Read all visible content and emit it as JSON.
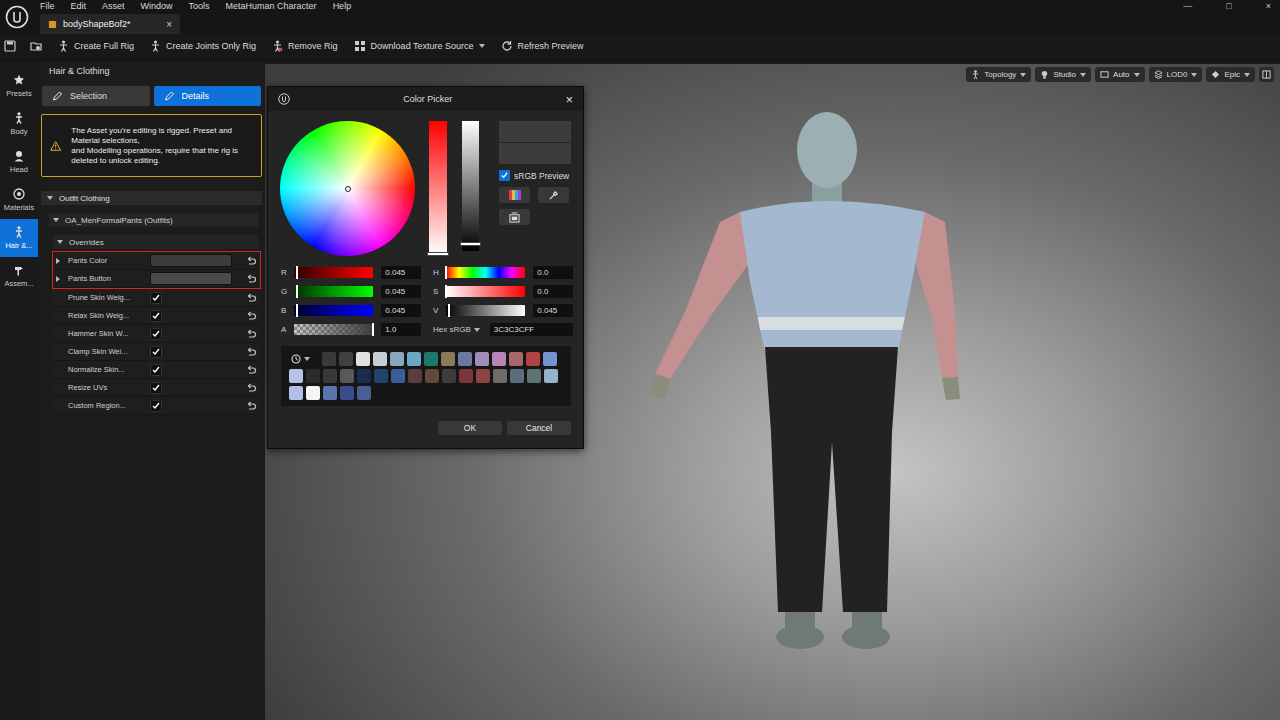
{
  "app": {
    "menu": [
      "File",
      "Edit",
      "Asset",
      "Window",
      "Tools",
      "MetaHuman Character",
      "Help"
    ],
    "window_controls": [
      "—",
      "□",
      "×"
    ],
    "document_tab": {
      "label": "bodyShapeBof2*",
      "close": "×",
      "selected": true
    }
  },
  "toolbar": [
    {
      "label": "Create Full Rig",
      "kind": "rig"
    },
    {
      "label": "Create Joints Only Rig",
      "kind": "joints"
    },
    {
      "label": "Remove Rig",
      "kind": "remove"
    },
    {
      "label": "Download Texture Source",
      "kind": "download",
      "dropdown": true
    },
    {
      "label": "Refresh Preview",
      "kind": "refresh"
    }
  ],
  "rail": [
    {
      "label": "Presets",
      "kind": "star",
      "selected": false
    },
    {
      "label": "Body",
      "kind": "body",
      "selected": false
    },
    {
      "label": "Head",
      "kind": "head",
      "selected": false
    },
    {
      "label": "Materials",
      "kind": "materials",
      "selected": false
    },
    {
      "label": "Hair &...",
      "kind": "hair",
      "selected": true
    },
    {
      "label": "Assem...",
      "kind": "hammer",
      "selected": false
    }
  ],
  "panel": {
    "title": "Hair & Clothing",
    "tabs": [
      {
        "label": "Selection",
        "selected": false
      },
      {
        "label": "Details",
        "selected": true
      }
    ],
    "warning": "The Asset you're editing is rigged. Preset and Material selections,\nand Modelling operations, require that the rig is deleted to unlock editing.",
    "section": {
      "label": "Outfit Clothing",
      "expanded": true
    },
    "outfit": {
      "label": "OA_MenFormalPants (Outfits)",
      "expanded": true
    },
    "group": {
      "label": "Overrides",
      "expanded": true
    },
    "rows": [
      {
        "label": "Pants Color",
        "kind": "color",
        "color": "#3c3c3c",
        "expanded": false,
        "highlighted": true
      },
      {
        "label": "Pants Button",
        "kind": "color",
        "color": "#4a4a4a",
        "expanded": false,
        "highlighted": true
      },
      {
        "label": "Prune Skin Weig...",
        "kind": "checkbox",
        "checked": true,
        "highlighted": false
      },
      {
        "label": "Relax Skin Weig...",
        "kind": "checkbox",
        "checked": true,
        "highlighted": false
      },
      {
        "label": "Hammer Skin W...",
        "kind": "checkbox",
        "checked": true,
        "highlighted": false
      },
      {
        "label": "Clamp Skin Wei...",
        "kind": "checkbox",
        "checked": true,
        "highlighted": false
      },
      {
        "label": "Normalize Skin...",
        "kind": "checkbox",
        "checked": true,
        "highlighted": false
      },
      {
        "label": "Resize UVs",
        "kind": "checkbox",
        "checked": true,
        "highlighted": false
      },
      {
        "label": "Custom Region...",
        "kind": "checkbox",
        "checked": true,
        "highlighted": false
      }
    ]
  },
  "viewport": {
    "controls": [
      {
        "label": "Topology",
        "kind": "figure"
      },
      {
        "label": "Studio",
        "kind": "bulb"
      },
      {
        "label": "Auto",
        "kind": "screen"
      },
      {
        "label": "LOD0",
        "kind": "stack"
      },
      {
        "label": "Epic",
        "kind": "diamond"
      }
    ]
  },
  "color_picker": {
    "title": "Color Picker",
    "close": "×",
    "wheel": {
      "hue": 0.0,
      "saturation": 0.0
    },
    "vertical_sliders": [
      {
        "kind": "saturation",
        "level": 0.0
      },
      {
        "kind": "value",
        "level": 0.045
      }
    ],
    "preview": {
      "new": "#3c3c3c",
      "old": "#3c3c3c"
    },
    "srgb_preview": {
      "label": "sRGB Preview",
      "checked": true
    },
    "channels": [
      {
        "label": "R",
        "value": "0.045",
        "level": 0.045,
        "kind": "red"
      },
      {
        "label": "G",
        "value": "0.045",
        "level": 0.045,
        "kind": "green"
      },
      {
        "label": "B",
        "value": "0.045",
        "level": 0.045,
        "kind": "blue"
      },
      {
        "label": "A",
        "value": "1.0",
        "level": 1.0,
        "kind": "alpha"
      }
    ],
    "hsv": [
      {
        "label": "H",
        "value": "0.0",
        "level": 0.0,
        "kind": "hue"
      },
      {
        "label": "S",
        "value": "0.0",
        "level": 0.0,
        "kind": "sat"
      },
      {
        "label": "V",
        "value": "0.045",
        "level": 0.045,
        "kind": "val"
      }
    ],
    "hex": {
      "label": "Hex sRGB",
      "value": "3C3C3CFF"
    },
    "swatches": [
      "#3a3a3a",
      "#404040",
      "#e0e0e0",
      "#c4ccd4",
      "#8aa6bc",
      "#6aa8c0",
      "#1c7a68",
      "#8c7a58",
      "#6a7aa0",
      "#a08cb8",
      "#b884b8",
      "#a86868",
      "#b04444",
      "#7294cc",
      "#b4c4e8",
      "#2c2c2c",
      "#383838",
      "#585858",
      "#1c2c4c",
      "#24406c",
      "#3c5c9c",
      "#5c3c3c",
      "#64483c",
      "#3c3c3c",
      "#7c3838",
      "#8c4444",
      "#6c6c6c",
      "#5c6c7c",
      "#5c7474",
      "#94b4cc",
      "#b0c0e8",
      "#f4f4f4",
      "#5c74ac",
      "#3c4c8c",
      "#4c5c94"
    ],
    "buttons": [
      {
        "label": "OK"
      },
      {
        "label": "Cancel"
      }
    ]
  }
}
